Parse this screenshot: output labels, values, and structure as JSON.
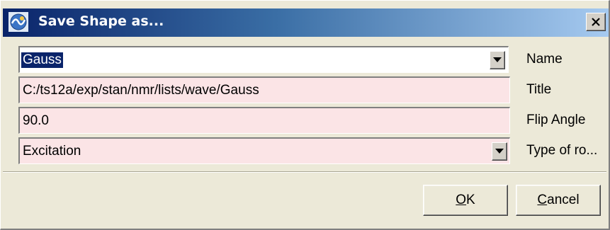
{
  "dialog": {
    "title": "Save Shape as...",
    "app_icon": "bruker-topspin-icon",
    "close_icon": "close-x-icon"
  },
  "fields": {
    "name": {
      "value": "Gauss",
      "label": "Name"
    },
    "title": {
      "value": "C:/ts12a/exp/stan/nmr/lists/wave/Gauss",
      "label": "Title"
    },
    "flip_angle": {
      "value": "90.0",
      "label": "Flip Angle"
    },
    "type": {
      "value": "Excitation",
      "label": "Type of ro..."
    }
  },
  "buttons": {
    "ok": {
      "mnemonic": "O",
      "rest": "K"
    },
    "cancel": {
      "mnemonic": "C",
      "rest": "ancel"
    }
  },
  "colors": {
    "field_background": "#fbe4e6",
    "selection": "#0a246a",
    "titlebar_start": "#0a246a",
    "titlebar_end": "#a6caf0"
  }
}
